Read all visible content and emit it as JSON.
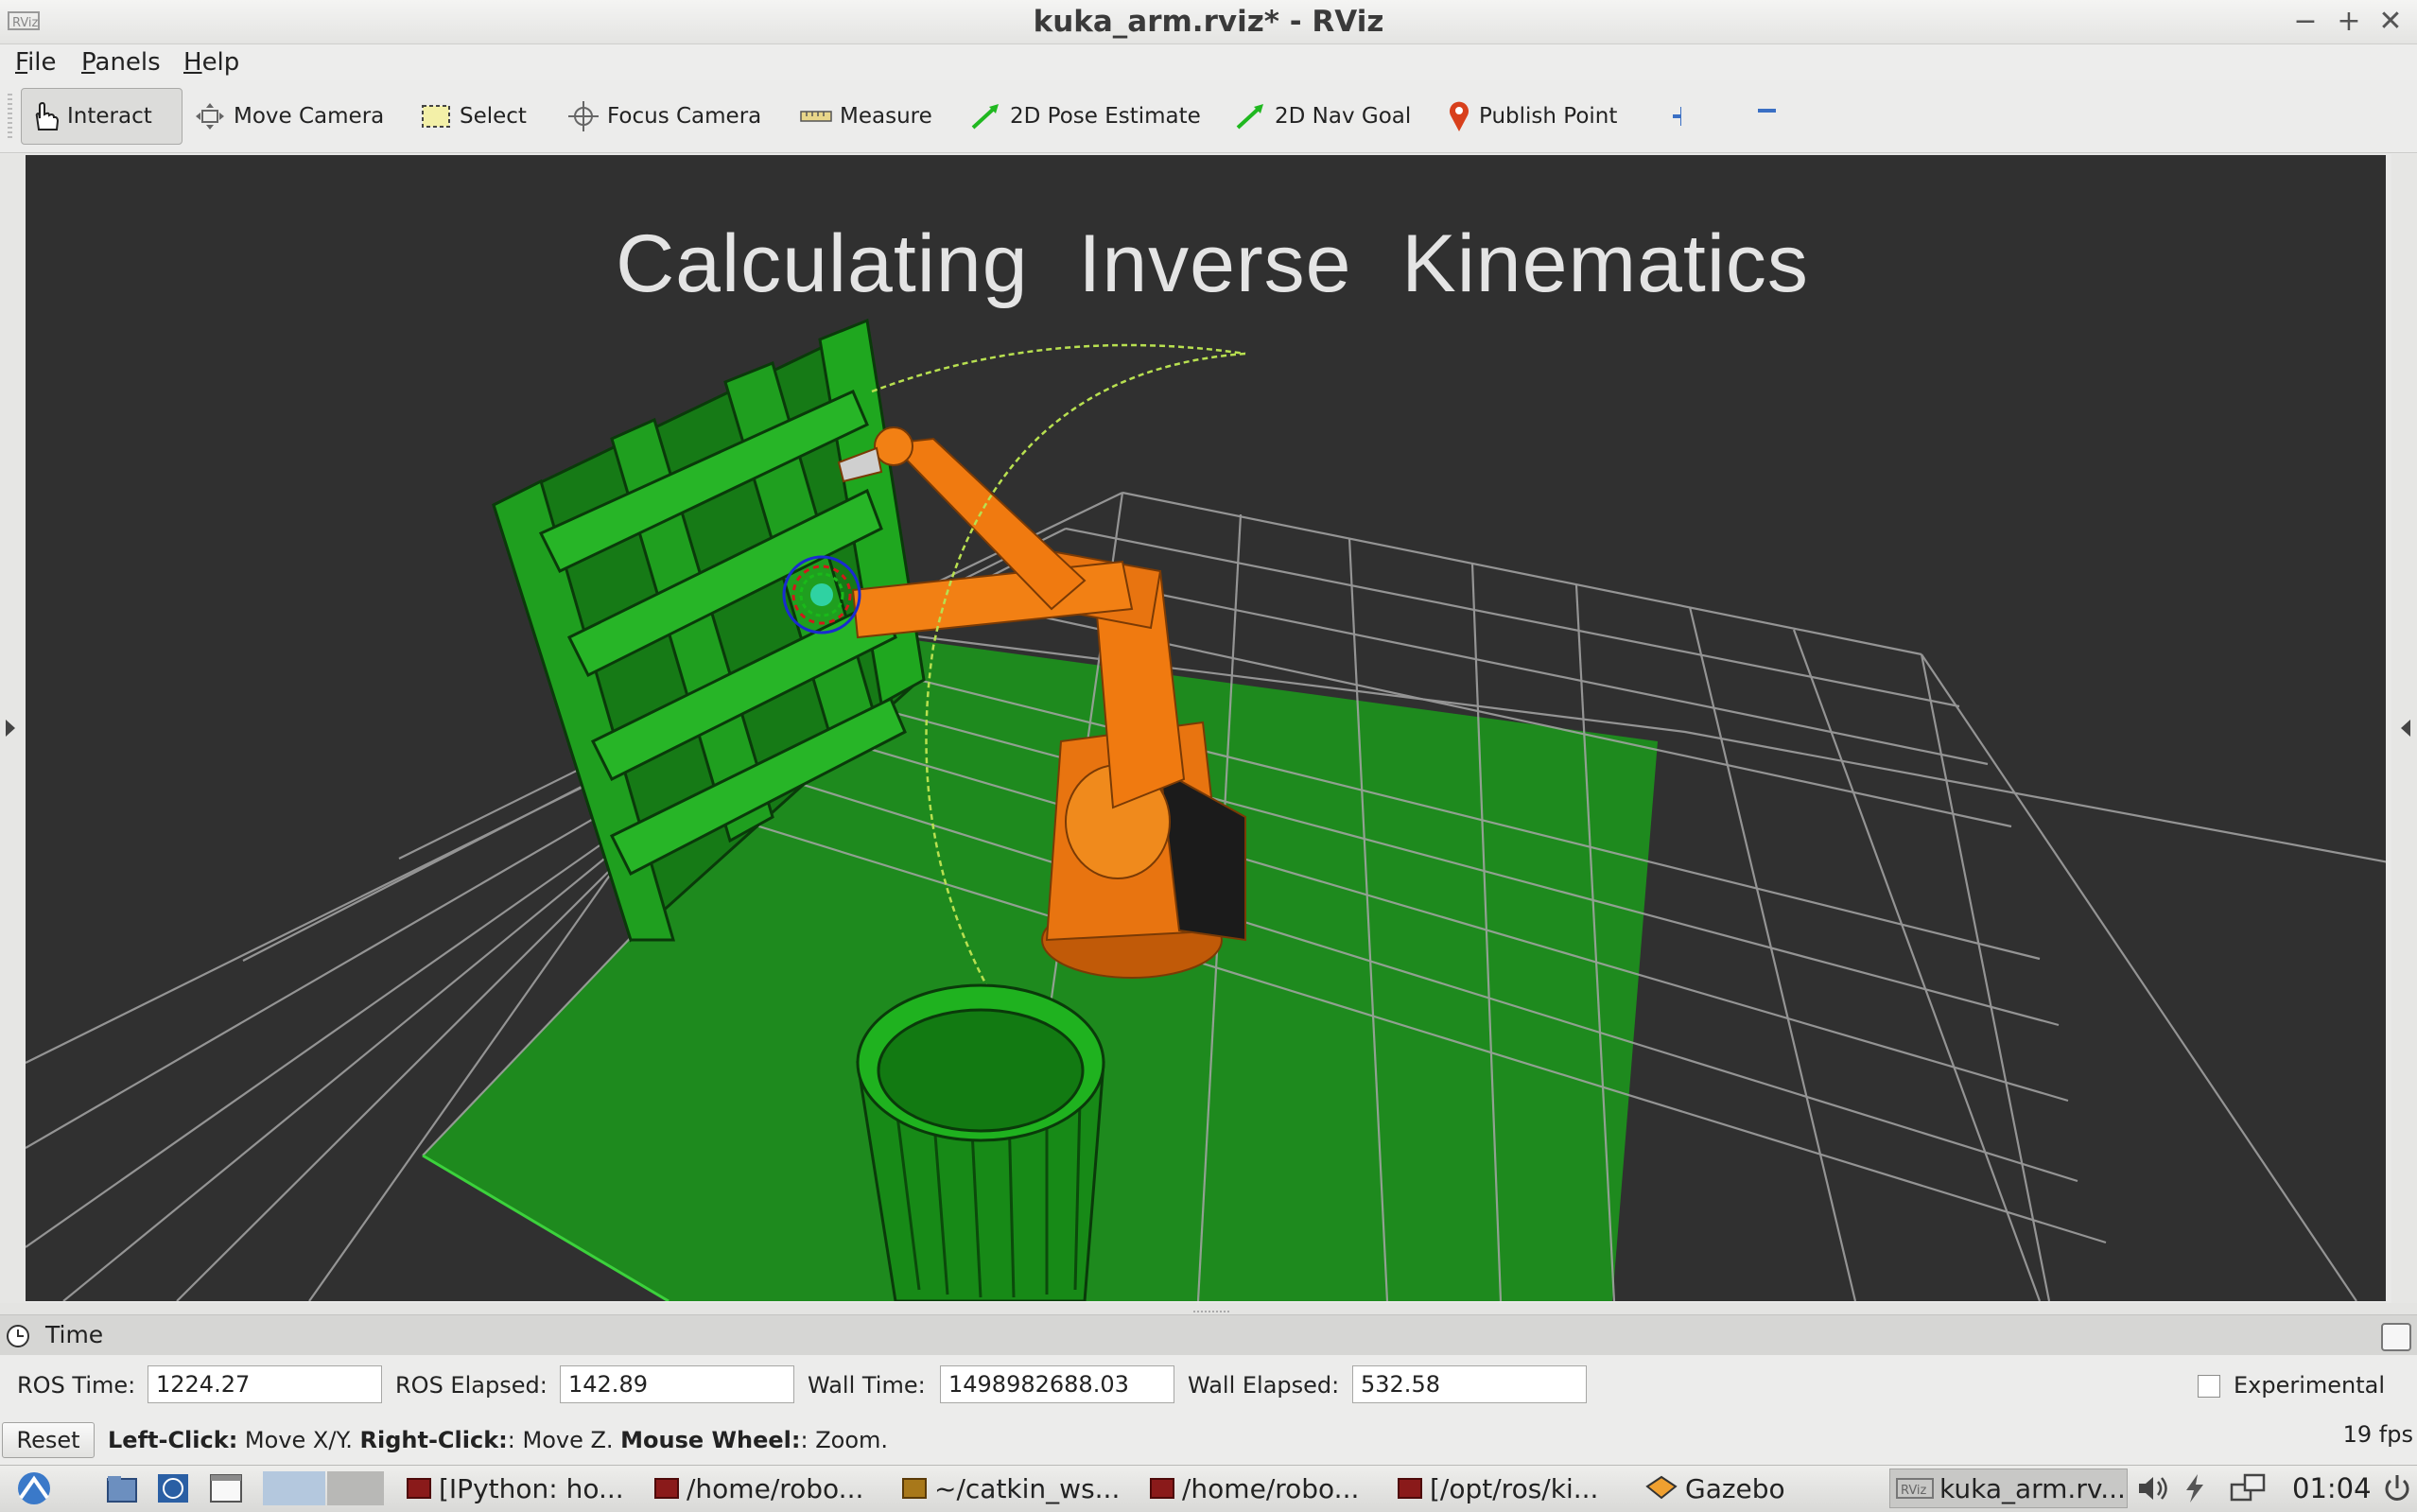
{
  "window": {
    "title": "kuka_arm.rviz* - RViz",
    "app_icon_label": "RViz",
    "controls": {
      "minimize": "−",
      "maximize": "+",
      "close": "✕"
    }
  },
  "menu": [
    {
      "label": "File",
      "mnemonic": "F",
      "rest": "ile"
    },
    {
      "label": "Panels",
      "mnemonic": "P",
      "rest": "anels"
    },
    {
      "label": "Help",
      "mnemonic": "H",
      "rest": "elp"
    }
  ],
  "toolbar": {
    "tools": [
      {
        "label": "Interact",
        "icon": "hand-icon",
        "active": true
      },
      {
        "label": "Move Camera",
        "icon": "move-camera-icon"
      },
      {
        "label": "Select",
        "icon": "select-rect-icon"
      },
      {
        "label": "Focus Camera",
        "icon": "crosshair-icon"
      },
      {
        "label": "Measure",
        "icon": "ruler-icon"
      },
      {
        "label": "2D Pose Estimate",
        "icon": "green-arrow-icon"
      },
      {
        "label": "2D Nav Goal",
        "icon": "green-arrow-icon"
      },
      {
        "label": "Publish Point",
        "icon": "map-pin-icon"
      }
    ],
    "add_tool_icon": "plus-icon",
    "remove_tool_icon": "minus-icon"
  },
  "viewport": {
    "overlay_text": "Calculating Inverse Kinematics",
    "colors": {
      "background": "#303030",
      "grid": "#a0a0a0",
      "floor": "#1e8a1e",
      "robot": "#f07a10",
      "shelf": "#1f9a1f",
      "bin": "#1fa21f"
    }
  },
  "time_panel": {
    "title": "Time",
    "ros_time_label": "ROS Time:",
    "ros_time_value": "1224.27",
    "ros_elapsed_label": "ROS Elapsed:",
    "ros_elapsed_value": "142.89",
    "wall_time_label": "Wall Time:",
    "wall_time_value": "1498982688.03",
    "wall_elapsed_label": "Wall Elapsed:",
    "wall_elapsed_value": "532.58",
    "experimental_label": "Experimental",
    "experimental_checked": false
  },
  "status": {
    "reset_label": "Reset",
    "hint": [
      {
        "bold": "Left-Click:",
        "text": " Move X/Y. "
      },
      {
        "bold": "Right-Click:",
        "text": ": Move Z. "
      },
      {
        "bold": "Mouse Wheel:",
        "text": ": Zoom."
      }
    ],
    "fps": "19 fps"
  },
  "taskbar": {
    "tasks": [
      {
        "label": "[IPython: ho..."
      },
      {
        "label": "/home/robo..."
      },
      {
        "label": "~/catkin_ws..."
      },
      {
        "label": "/home/robo..."
      },
      {
        "label": "[/opt/ros/ki..."
      },
      {
        "label": "Gazebo"
      },
      {
        "label": "kuka_arm.rv...",
        "current": true
      }
    ],
    "tray_icons": [
      "volume-icon",
      "power-icon",
      "network-icon"
    ],
    "clock": "01:04"
  }
}
